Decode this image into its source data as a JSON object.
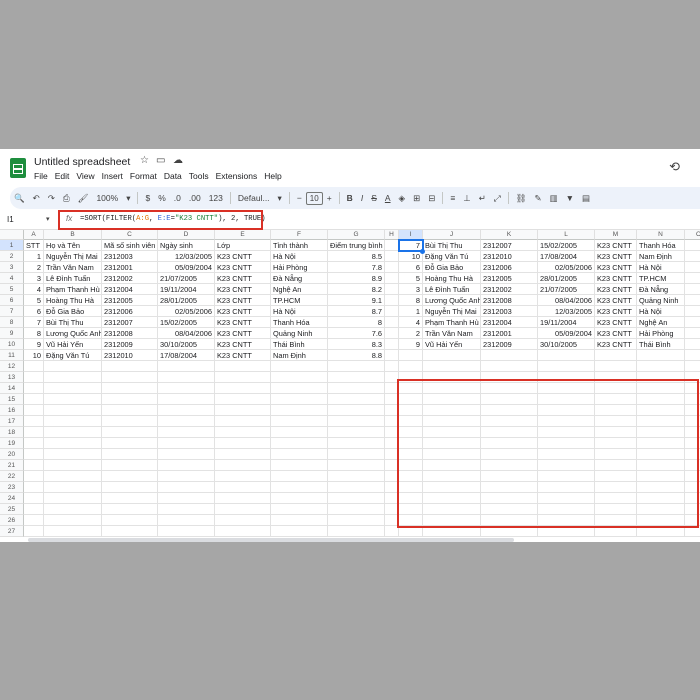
{
  "app": {
    "title": "Untitled spreadsheet",
    "menus": [
      "File",
      "Edit",
      "View",
      "Insert",
      "Format",
      "Data",
      "Tools",
      "Extensions",
      "Help"
    ]
  },
  "toolbar": {
    "zoom": "100%",
    "currency": "$",
    "percent": "%",
    "decimal_dec": ".0",
    "decimal_inc": ".00",
    "number_format": "123",
    "font": "Defaul...",
    "font_size": "10"
  },
  "formula": {
    "cell_ref": "I1",
    "parts": [
      {
        "text": "=SORT(FILTER(",
        "color": "default"
      },
      {
        "text": "A:G",
        "color": "orange"
      },
      {
        "text": ", ",
        "color": "default"
      },
      {
        "text": "E:E",
        "color": "blue"
      },
      {
        "text": "=",
        "color": "default"
      },
      {
        "text": "\"K23 CNTT\"",
        "color": "green"
      },
      {
        "text": "), 2, TRUE)",
        "color": "default"
      }
    ]
  },
  "columns": [
    "A",
    "B",
    "C",
    "D",
    "E",
    "F",
    "G",
    "H",
    "I",
    "J",
    "K",
    "L",
    "M",
    "N",
    "O"
  ],
  "rows": [
    "1",
    "2",
    "3",
    "4",
    "5",
    "6",
    "7",
    "8",
    "9",
    "10",
    "11",
    "12",
    "13",
    "14",
    "15",
    "16",
    "17",
    "18",
    "19",
    "20",
    "21",
    "22",
    "23",
    "24",
    "25",
    "26",
    "27"
  ],
  "headers": [
    "STT",
    "Họ và Tên",
    "Mã số sinh viên",
    "Ngày sinh",
    "Lớp",
    "Tỉnh thành",
    "Điểm trung bình"
  ],
  "source_rows": [
    [
      "1",
      "Nguyễn Thị Mai",
      "2312003",
      "12/03/2005",
      "K23 CNTT",
      "Hà Nội",
      "8.5"
    ],
    [
      "2",
      "Trần Văn Nam",
      "2312001",
      "05/09/2004",
      "K23 CNTT",
      "Hải Phòng",
      "7.8"
    ],
    [
      "3",
      "Lê Đình Tuấn",
      "2312002",
      "21/07/2005",
      "K23 CNTT",
      "Đà Nẵng",
      "8.9"
    ],
    [
      "4",
      "Phạm Thanh Hù",
      "2312004",
      "19/11/2004",
      "K23 CNTT",
      "Nghệ An",
      "8.2"
    ],
    [
      "5",
      "Hoàng Thu Hà",
      "2312005",
      "28/01/2005",
      "K23 CNTT",
      "TP.HCM",
      "9.1"
    ],
    [
      "6",
      "Đỗ Gia Bảo",
      "2312006",
      "02/05/2006",
      "K23 CNTT",
      "Hà Nội",
      "8.7"
    ],
    [
      "7",
      "Bùi Thị Thu",
      "2312007",
      "15/02/2005",
      "K23 CNTT",
      "Thanh Hóa",
      "8"
    ],
    [
      "8",
      "Lương Quốc Anh",
      "2312008",
      "08/04/2006",
      "K23 CNTT",
      "Quảng Ninh",
      "7.6"
    ],
    [
      "9",
      "Vũ Hải Yến",
      "2312009",
      "30/10/2005",
      "K23 CNTT",
      "Thái Bình",
      "8.3"
    ],
    [
      "10",
      "Đặng Văn Tú",
      "2312010",
      "17/08/2004",
      "K23 CNTT",
      "Nam Định",
      "8.8"
    ]
  ],
  "result_rows": [
    [
      "7",
      "Bùi Thị Thu",
      "2312007",
      "15/02/2005",
      "K23 CNTT",
      "Thanh Hóa",
      "8"
    ],
    [
      "10",
      "Đặng Văn Tú",
      "2312010",
      "17/08/2004",
      "K23 CNTT",
      "Nam Định",
      "8.8"
    ],
    [
      "6",
      "Đỗ Gia Bảo",
      "2312006",
      "02/05/2006",
      "K23 CNTT",
      "Hà Nội",
      "8.7"
    ],
    [
      "5",
      "Hoàng Thu Hà",
      "2312005",
      "28/01/2005",
      "K23 CNTT",
      "TP.HCM",
      "9.1"
    ],
    [
      "3",
      "Lê Đình Tuấn",
      "2312002",
      "21/07/2005",
      "K23 CNTT",
      "Đà Nẵng",
      "8.9"
    ],
    [
      "8",
      "Lương Quốc Anh",
      "2312008",
      "08/04/2006",
      "K23 CNTT",
      "Quảng Ninh",
      "7.6"
    ],
    [
      "1",
      "Nguyễn Thị Mai",
      "2312003",
      "12/03/2005",
      "K23 CNTT",
      "Hà Nội",
      "8.5"
    ],
    [
      "4",
      "Phạm Thanh Hù",
      "2312004",
      "19/11/2004",
      "K23 CNTT",
      "Nghệ An",
      "8.2"
    ],
    [
      "2",
      "Trần Văn Nam",
      "2312001",
      "05/09/2004",
      "K23 CNTT",
      "Hải Phòng",
      "7.8"
    ],
    [
      "9",
      "Vũ Hải Yến",
      "2312009",
      "30/10/2005",
      "K23 CNTT",
      "Thái Bình",
      "8.3"
    ]
  ],
  "colors": {
    "highlight": "#d93025",
    "selection": "#1a73e8",
    "sheets_green": "#1e8e3e"
  }
}
